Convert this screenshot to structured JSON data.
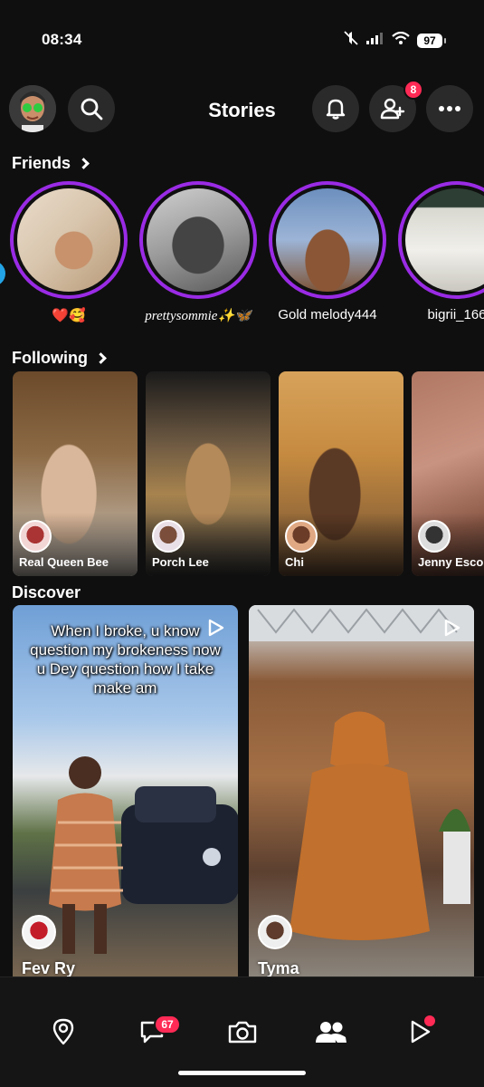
{
  "status_bar": {
    "time": "08:34",
    "battery": "97"
  },
  "header": {
    "title": "Stories",
    "friend_requests_badge": "8"
  },
  "friends": {
    "heading": "Friends",
    "items": [
      {
        "label": "❤️🥰",
        "italic": false
      },
      {
        "label": "prettysommie✨🦋",
        "italic": true
      },
      {
        "label": "Gold melody444",
        "italic": false
      },
      {
        "label": "bigrii_166",
        "italic": false
      }
    ]
  },
  "following": {
    "heading": "Following",
    "items": [
      {
        "name": "Real Queen Bee"
      },
      {
        "name": "Porch Lee"
      },
      {
        "name": "Chi"
      },
      {
        "name": "Jenny Escobar"
      }
    ]
  },
  "discover": {
    "heading": "Discover",
    "items": [
      {
        "caption": "When I broke, u know question my brokeness now u Dey question how I take make am",
        "name": "Fev Ry"
      },
      {
        "caption": "",
        "name": "Tyma"
      }
    ]
  },
  "bottom_nav": {
    "items": [
      "map-pin-icon",
      "chat-icon",
      "camera-icon",
      "friends-icon",
      "play-icon"
    ],
    "chat_badge": "67"
  },
  "colors": {
    "story_ring": "#9a2be5",
    "badge": "#ff2a55",
    "background": "#0f0f0f"
  }
}
